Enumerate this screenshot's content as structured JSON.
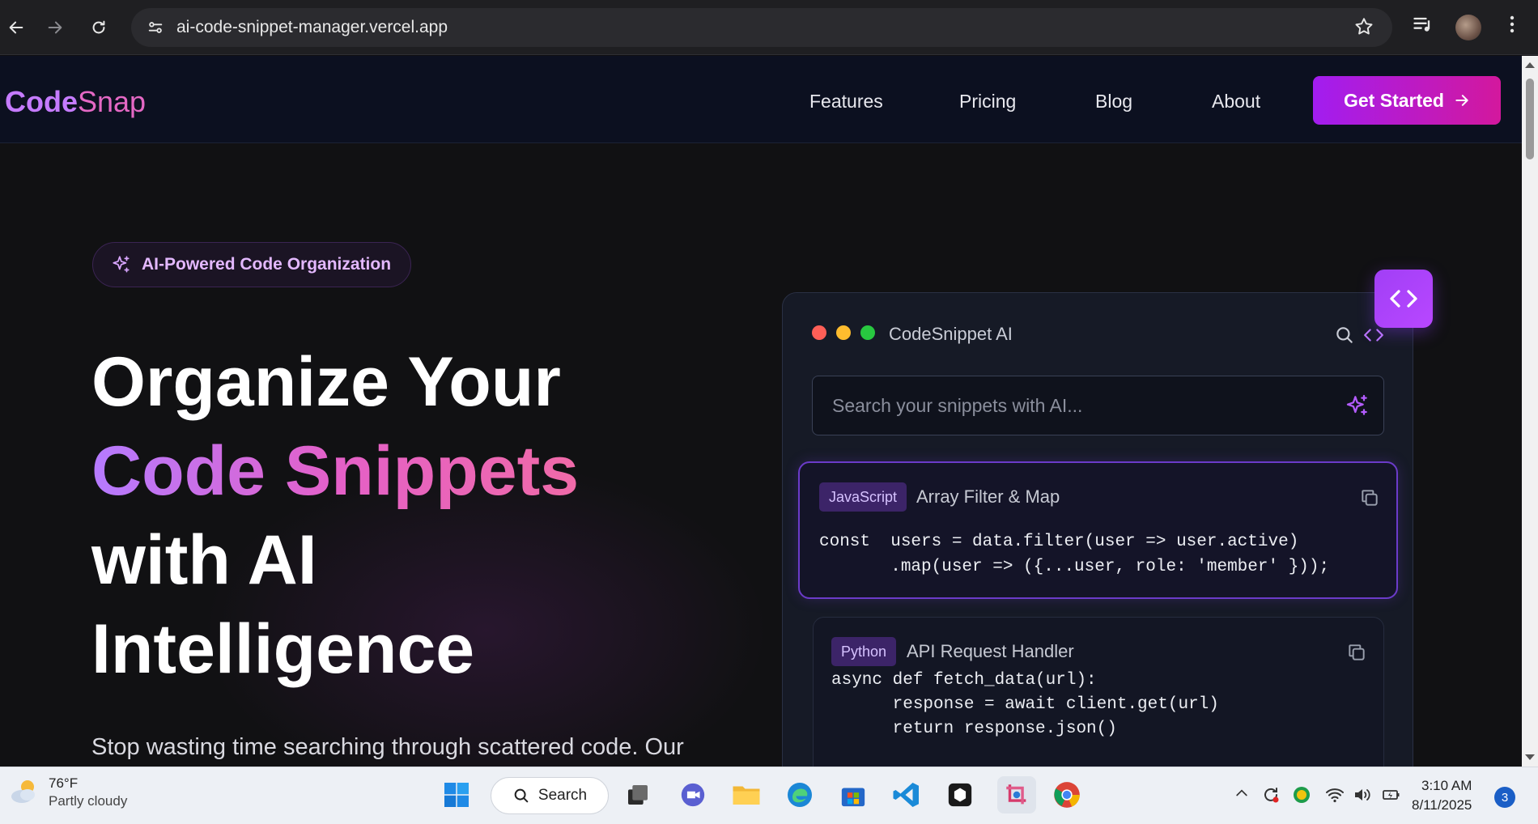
{
  "browser": {
    "url": "ai-code-snippet-manager.vercel.app"
  },
  "site": {
    "logo_part1": "Code",
    "logo_part2": "Snap",
    "nav": [
      "Features",
      "Pricing",
      "Blog",
      "About"
    ],
    "cta_label": "Get Started"
  },
  "hero": {
    "badge": "AI-Powered Code Organization",
    "title_line1": "Organize Your",
    "title_line2": "Code Snippets",
    "title_line3": "with AI",
    "title_line4": "Intelligence",
    "subtitle": "Stop wasting time searching through scattered code. Our"
  },
  "panel": {
    "title": "CodeSnippet AI",
    "search_placeholder": "Search your snippets with AI...",
    "snippets": [
      {
        "language": "JavaScript",
        "title": "Array Filter & Map",
        "code": "const  users = data.filter(user => user.active)\n       .map(user => ({...user, role: 'member' }));"
      },
      {
        "language": "Python",
        "title": "API Request Handler",
        "code": "async def fetch_data(url):\n      response = await client.get(url)\n      return response.json()"
      }
    ]
  },
  "taskbar": {
    "temperature": "76°F",
    "weather": "Partly cloudy",
    "search_label": "Search",
    "time": "3:10 AM",
    "date": "8/11/2025",
    "notification_count": "3"
  },
  "colors": {
    "accent_purple": "#a21df0",
    "accent_pink": "#d3189d",
    "dot_red": "#ff5f57",
    "dot_yellow": "#febc2e",
    "dot_green": "#28c840"
  }
}
